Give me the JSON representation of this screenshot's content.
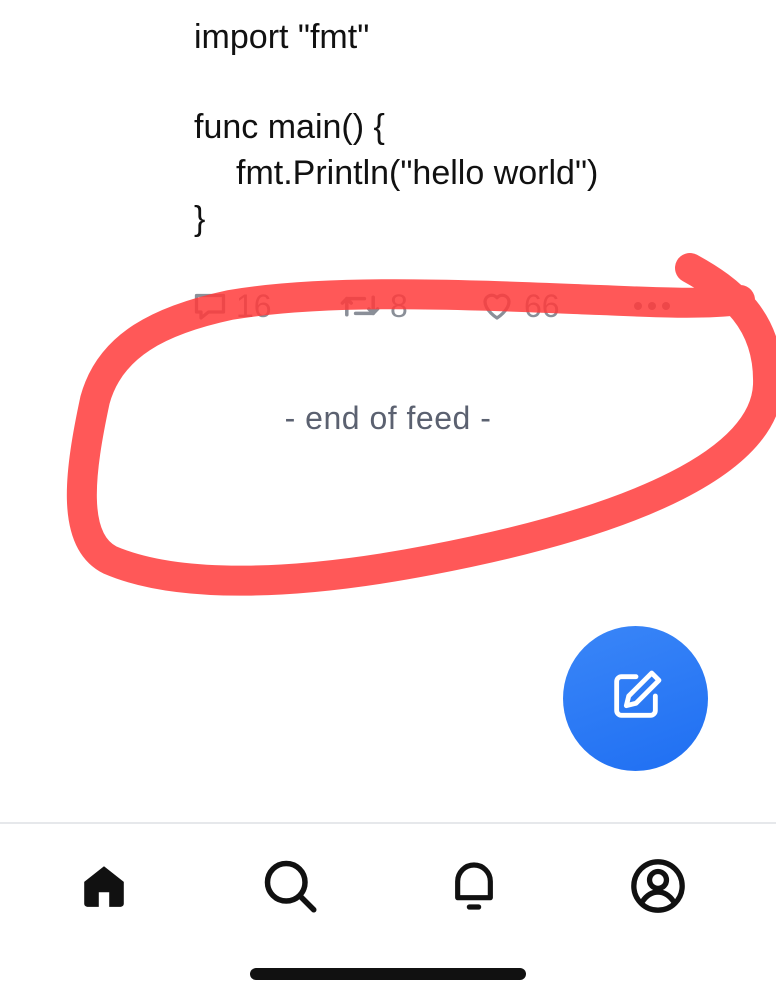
{
  "post": {
    "code_lines": [
      "import \"fmt\"",
      "",
      "func main() {",
      "fmt.Println(\"hello world\")",
      "}"
    ]
  },
  "actions": {
    "reply_count": "16",
    "repost_count": "8",
    "like_count": "66",
    "more_icon": "ellipsis-icon"
  },
  "feed": {
    "end_text": "- end of feed -"
  },
  "fab": {
    "icon": "compose-icon"
  },
  "nav": {
    "items": [
      {
        "name": "home",
        "icon": "home-icon",
        "active": true
      },
      {
        "name": "search",
        "icon": "search-icon",
        "active": false
      },
      {
        "name": "notifications",
        "icon": "bell-icon",
        "active": false
      },
      {
        "name": "profile",
        "icon": "profile-icon",
        "active": false
      }
    ]
  },
  "colors": {
    "accent": "#1f6ff2",
    "annotation": "#ff3b3b",
    "muted": "#8a8f98"
  }
}
